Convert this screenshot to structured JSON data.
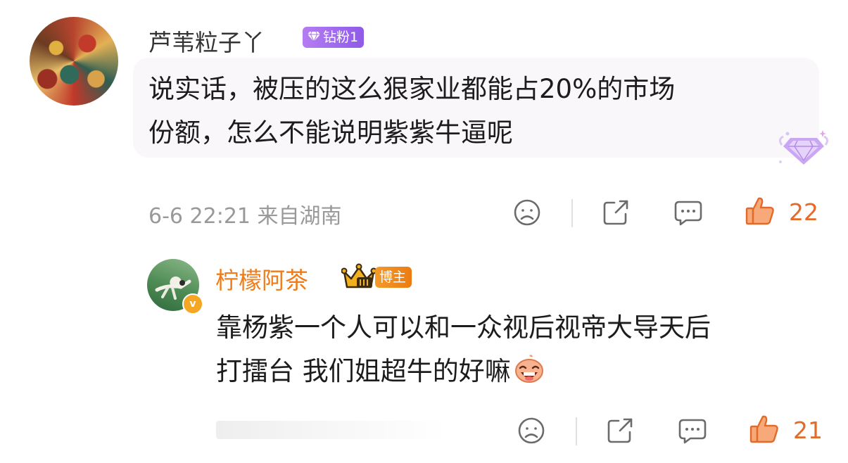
{
  "comment": {
    "avatar_icon": "user-avatar",
    "username": "芦苇粒子丫",
    "badge_icon": "diamond-icon",
    "badge_text": "钻粉1",
    "content_line1": "说实话，被压的这么狠家业都能占20%的市场",
    "content_line2": "份额，怎么不能说明紫紫牛逼呢",
    "meta": "6-6 22:21 来自湖南",
    "like_count": "22",
    "accent_color": "#e36b2a"
  },
  "reply": {
    "avatar_icon": "user-avatar",
    "verified_icon": "verified-v-icon",
    "verified_mark": "v",
    "username": "柠檬阿茶",
    "crown_icon": "crown-level-3-icon",
    "badge_text": "博主",
    "content_line1": "靠杨紫一个人可以和一众视后视帝大导天后",
    "content_line2": "打擂台 我们姐超牛的好嘛",
    "emoji_icon": "laughing-emoji-icon",
    "like_count": "21",
    "name_color": "#ef7c18"
  }
}
